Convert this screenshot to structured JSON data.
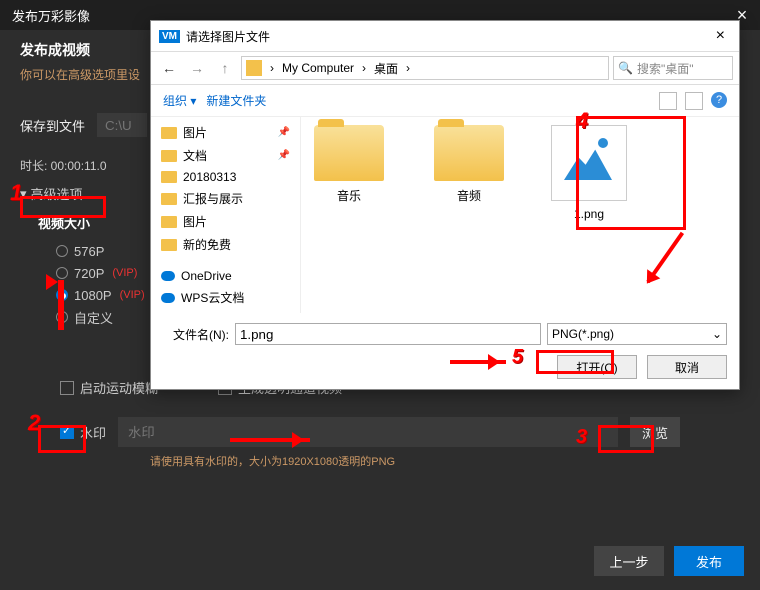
{
  "main": {
    "title": "发布万彩影像",
    "subtitle": "发布成视频",
    "tip": "你可以在高级选项里设",
    "save_to_label": "保存到文件",
    "path_placeholder": "C:\\U",
    "duration": "时长: 00:00:11.0",
    "advanced": "高级选项",
    "video_size_title": "视频大小",
    "sizes": {
      "p576": "576P",
      "p720": "720P",
      "p1080": "1080P",
      "custom": "自定义"
    },
    "vip": "(VIP)",
    "motion_blur": "启动运动模糊",
    "alpha_video": "生成透明通道视频",
    "watermark_label": "水印",
    "wm_placeholder": "水印",
    "browse": "浏览",
    "wm_tip": "请使用具有水印的，大小为1920X1080透明的PNG",
    "prev": "上一步",
    "publish": "发布"
  },
  "dialog": {
    "vm": "VM",
    "title": "请选择图片文件",
    "crumb1": "My Computer",
    "crumb2": "桌面",
    "search_ph": "搜索\"桌面\"",
    "organize": "组织",
    "new_folder": "新建文件夹",
    "tree": {
      "pics": "图片",
      "docs": "文档",
      "date": "20180313",
      "report": "汇报与展示",
      "pics2": "图片",
      "free": "新的免费",
      "onedrive": "OneDrive",
      "wps": "WPS云文档"
    },
    "folders": {
      "music": "音乐",
      "audio": "音频"
    },
    "file1": "1.png",
    "fn_label": "文件名(N):",
    "fn_value": "1.png",
    "filter": "PNG(*.png)",
    "open": "打开(O)",
    "cancel": "取消"
  },
  "ann": {
    "n1": "1",
    "n2": "2",
    "n3": "3",
    "n4": "4",
    "n5": "5"
  }
}
